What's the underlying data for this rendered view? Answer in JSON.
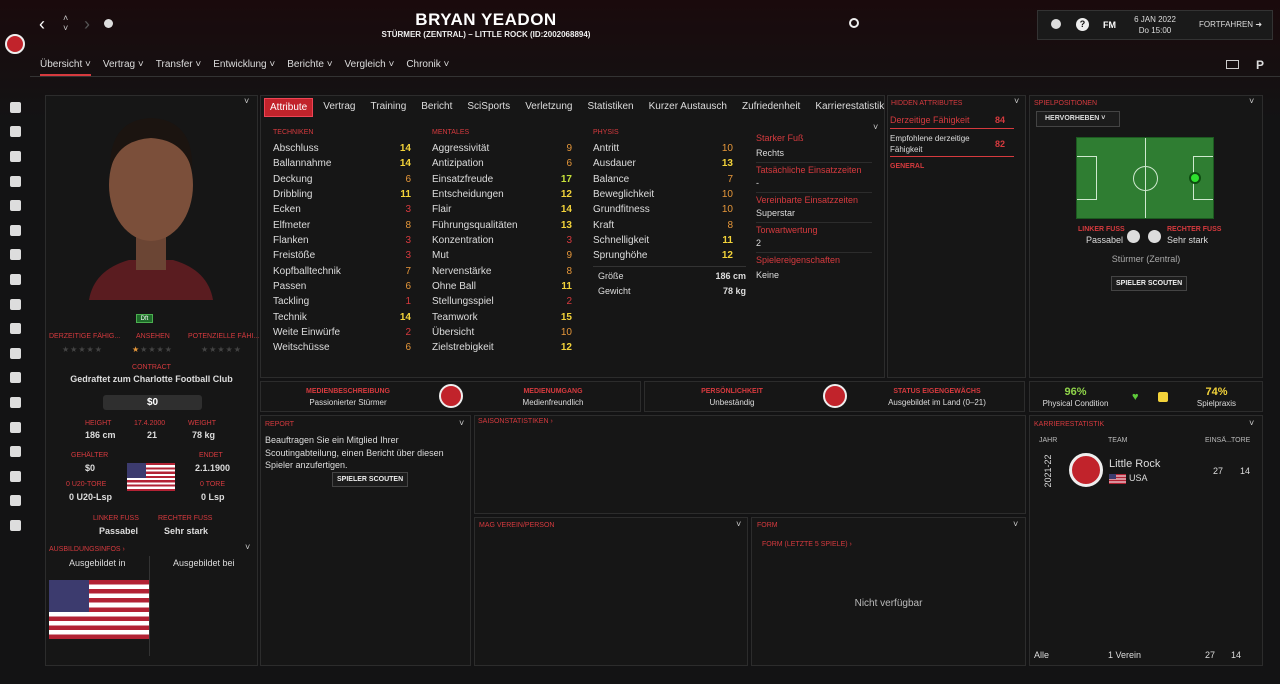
{
  "header": {
    "player_name": "BRYAN YEADON",
    "subtitle": "STÜRMER (ZENTRAL) – LITTLE ROCK (ID:2002068894)",
    "date": "6 JAN 2022",
    "time": "Do 15:00",
    "continue": "FORTFAHREN",
    "fm": "FM"
  },
  "nav": [
    {
      "label": "Übersicht"
    },
    {
      "label": "Vertrag"
    },
    {
      "label": "Transfer"
    },
    {
      "label": "Entwicklung"
    },
    {
      "label": "Berichte"
    },
    {
      "label": "Vergleich"
    },
    {
      "label": "Chronik"
    }
  ],
  "tabs": [
    "Attribute",
    "Vertrag",
    "Training",
    "Bericht",
    "SciSports",
    "Verletzung",
    "Statistiken",
    "Kurzer Austausch",
    "Zufriedenheit",
    "Karrierestatistik"
  ],
  "technical": {
    "title": "TECHNIKEN",
    "rows": [
      [
        "Abschluss",
        "14",
        "y"
      ],
      [
        "Ballannahme",
        "14",
        "y"
      ],
      [
        "Deckung",
        "6",
        "o"
      ],
      [
        "Dribbling",
        "11",
        "y"
      ],
      [
        "Ecken",
        "3",
        "r"
      ],
      [
        "Elfmeter",
        "8",
        "o"
      ],
      [
        "Flanken",
        "3",
        "r"
      ],
      [
        "Freistöße",
        "3",
        "r"
      ],
      [
        "Kopfballtechnik",
        "7",
        "o"
      ],
      [
        "Passen",
        "6",
        "o"
      ],
      [
        "Tackling",
        "1",
        "r"
      ],
      [
        "Technik",
        "14",
        "y"
      ],
      [
        "Weite Einwürfe",
        "2",
        "r"
      ],
      [
        "Weitschüsse",
        "6",
        "o"
      ]
    ]
  },
  "mental": {
    "title": "MENTALES",
    "rows": [
      [
        "Aggressivität",
        "9",
        "o"
      ],
      [
        "Antizipation",
        "6",
        "o"
      ],
      [
        "Einsatzfreude",
        "17",
        "g"
      ],
      [
        "Entscheidungen",
        "12",
        "y"
      ],
      [
        "Flair",
        "14",
        "y"
      ],
      [
        "Führungsqualitäten",
        "13",
        "y"
      ],
      [
        "Konzentration",
        "3",
        "r"
      ],
      [
        "Mut",
        "9",
        "o"
      ],
      [
        "Nervenstärke",
        "8",
        "o"
      ],
      [
        "Ohne Ball",
        "11",
        "y"
      ],
      [
        "Stellungsspiel",
        "2",
        "r"
      ],
      [
        "Teamwork",
        "15",
        "y"
      ],
      [
        "Übersicht",
        "10",
        "o"
      ],
      [
        "Zielstrebigkeit",
        "12",
        "y"
      ]
    ]
  },
  "physical": {
    "title": "PHYSIS",
    "rows": [
      [
        "Antritt",
        "10",
        "o"
      ],
      [
        "Ausdauer",
        "13",
        "y"
      ],
      [
        "Balance",
        "7",
        "o"
      ],
      [
        "Beweglichkeit",
        "10",
        "o"
      ],
      [
        "Grundfitness",
        "10",
        "o"
      ],
      [
        "Kraft",
        "8",
        "o"
      ],
      [
        "Schnelligkeit",
        "11",
        "y"
      ],
      [
        "Sprunghöhe",
        "12",
        "y"
      ]
    ],
    "height_label": "Größe",
    "height": "186 cm",
    "weight_label": "Gewicht",
    "weight": "78 kg"
  },
  "side_info": {
    "strong_foot_label": "Starker Fuß",
    "strong_foot": "Rechts",
    "actual_apps_label": "Tatsächliche Einsatzzeiten",
    "actual_apps": "-",
    "agreed_apps_label": "Vereinbarte Einsatzzeiten",
    "agreed_apps": "Superstar",
    "gk_rating_label": "Torwartwertung",
    "gk_rating": "2",
    "traits_label": "Spielereigenschaften",
    "traits": "Keine"
  },
  "hidden": {
    "title": "HIDDEN ATTRIBUTES",
    "current_label": "Derzeitige Fähigkeit",
    "current": "84",
    "rec_label": "Empfohlene derzeitige Fähigkeit",
    "rec": "82",
    "general": "GENERAL"
  },
  "positions": {
    "title": "SPIELPOSITIONEN",
    "highlight": "HERVORHEBEN",
    "left_foot_label": "LINKER FUSS",
    "left_foot": "Passabel",
    "right_foot_label": "RECHTER FUSS",
    "right_foot": "Sehr stark",
    "position": "Stürmer (Zentral)",
    "scout_btn": "SPIELER SCOUTEN"
  },
  "profile": {
    "badge": "Dft",
    "ca_label": "DERZEITIGE FÄHIG...",
    "rep_label": "ANSEHEN",
    "pa_label": "POTENZIELLE FÄHI...",
    "contract_label": "CONTRACT",
    "contract": "Gedraftet zum Charlotte Football Club",
    "wage_value": "$0",
    "height_label": "HEIGHT",
    "height": "186 cm",
    "age_label": "17.4.2000",
    "age": "21",
    "weight_label": "WEIGHT",
    "weight": "78 kg",
    "salary_label": "GEHÄLTER",
    "salary": "$0",
    "ends_label": "ENDET",
    "ends": "2.1.1900",
    "u20_goals_label": "0 U20-TORE",
    "u20_goals": "0 U20-Lsp",
    "goals_label": "0 TORE",
    "goals": "0 Lsp",
    "left_foot_label": "LINKER FUSS",
    "left_foot": "Passabel",
    "right_foot_label": "RECHTER FUSS",
    "right_foot": "Sehr stark",
    "training_label": "AUSBILDUNGSINFOS",
    "trained_in": "Ausgebildet in",
    "trained_at": "Ausgebildet bei"
  },
  "media": {
    "desc_label": "MEDIENBESCHREIBUNG",
    "desc": "Passionierter Stürmer",
    "handling_label": "MEDIENUMGANG",
    "handling": "Medienfreundlich",
    "personality_label": "PERSÖNLICHKEIT",
    "personality": "Unbeständig",
    "homegrown_label": "STATUS EIGENGEWÄCHS",
    "homegrown": "Ausgebildet im Land (0–21)"
  },
  "condition": {
    "physical": "96%",
    "physical_label": "Physical Condition",
    "practice": "74%",
    "practice_label": "Spielpraxis"
  },
  "report": {
    "title": "REPORT",
    "text": "Beauftragen Sie ein Mitglied Ihrer Scoutingabteilung, einen Bericht über diesen Spieler anzufertigen.",
    "btn": "SPIELER SCOUTEN"
  },
  "season": {
    "title": "SAISONSTATISTIKEN"
  },
  "mag": {
    "title": "MAG VEREIN/PERSON"
  },
  "form": {
    "title": "FORM",
    "sub": "FORM (LETZTE 5 SPIELE)",
    "empty": "Nicht verfügbar"
  },
  "career": {
    "title": "KARRIERESTATISTIK",
    "col_year": "JAHR",
    "col_team": "TEAM",
    "col_apps": "EINSÄ...",
    "col_goals": "TORE",
    "season": "2021-22",
    "team": "Little Rock",
    "country": "USA",
    "apps": "27",
    "goals": "14",
    "total_label": "Alle",
    "total_clubs": "1 Verein",
    "total_apps": "27",
    "total_goals": "14"
  },
  "sidebar": [
    "home-icon",
    "inbox-icon",
    "squad-icon",
    "tactics-icon",
    "data-icon",
    "dev-icon",
    "staff-icon",
    "medical-icon",
    "club-icon",
    "schedule-icon",
    "competitions-icon",
    "scouting-icon",
    "transfers-icon",
    "club-vision-icon",
    "finances-icon",
    "dev-centre-icon",
    "reports-icon",
    "manager-icon"
  ]
}
